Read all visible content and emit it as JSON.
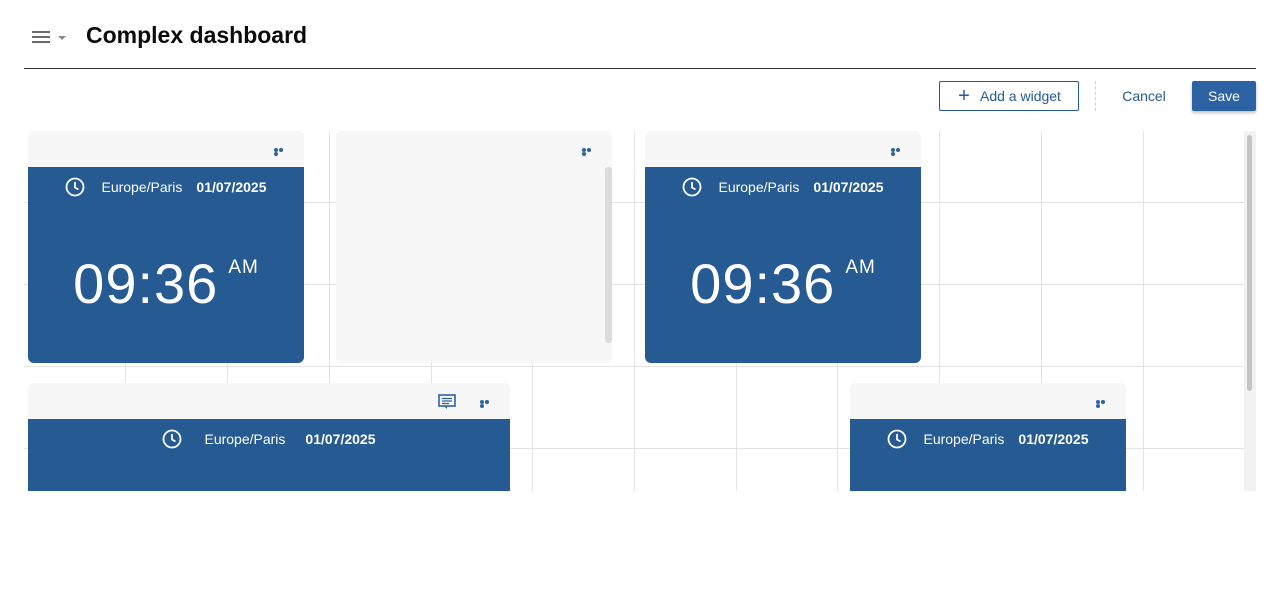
{
  "header": {
    "title": "Complex dashboard",
    "menu_icon": "hamburger-menu-icon"
  },
  "toolbar": {
    "add_widget_label": "Add a widget",
    "add_icon": "plus-icon",
    "cancel_label": "Cancel",
    "save_label": "Save"
  },
  "colors": {
    "accent": "#2c62a4",
    "widget_blue": "#255a93",
    "widget_header": "#f7f7f7"
  },
  "widgets": [
    {
      "type": "clock",
      "timezone": "Europe/Paris",
      "date": "01/07/2025",
      "time": "09:36",
      "ampm": "AM"
    },
    {
      "type": "empty"
    },
    {
      "type": "clock",
      "timezone": "Europe/Paris",
      "date": "01/07/2025",
      "time": "09:36",
      "ampm": "AM"
    },
    {
      "type": "clock",
      "timezone": "Europe/Paris",
      "date": "01/07/2025",
      "has_message_icon": true
    },
    {
      "type": "clock",
      "timezone": "Europe/Paris",
      "date": "01/07/2025"
    }
  ]
}
